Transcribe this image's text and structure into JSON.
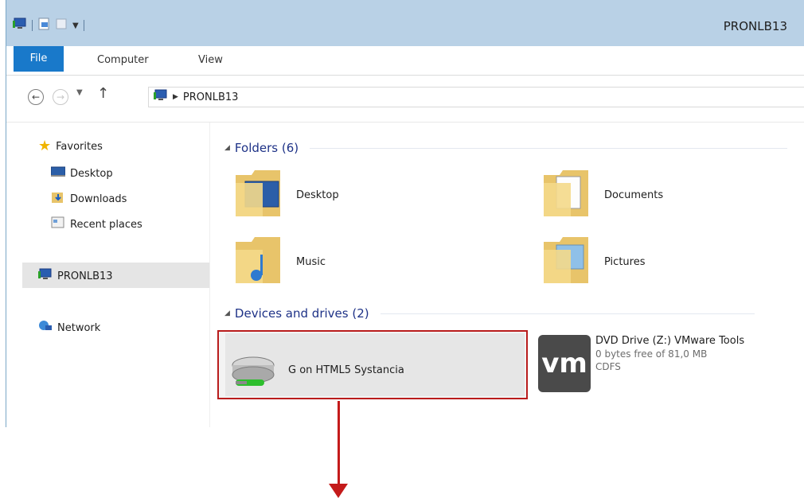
{
  "window": {
    "title": "PRONLB13"
  },
  "ribbon": {
    "tabs": [
      "File",
      "Computer",
      "View"
    ]
  },
  "address": {
    "path": "PRONLB13"
  },
  "sidebar": {
    "favorites": "Favorites",
    "items": [
      "Desktop",
      "Downloads",
      "Recent places"
    ],
    "computer": "PRONLB13",
    "network": "Network"
  },
  "folders": {
    "header": "Folders (6)",
    "items": [
      "Desktop",
      "Documents",
      "Music",
      "Pictures"
    ]
  },
  "devices": {
    "header": "Devices and drives (2)",
    "drive_label": "G on HTML5 Systancia",
    "dvd_title": "DVD Drive (Z:) VMware Tools",
    "dvd_free": "0 bytes free of 81,0 MB",
    "dvd_fs": "CDFS",
    "vm_logo": "vm"
  },
  "colors": {
    "accent": "#1979ca",
    "highlight": "#c41a1a",
    "titlebar": "#b9d1e6"
  }
}
